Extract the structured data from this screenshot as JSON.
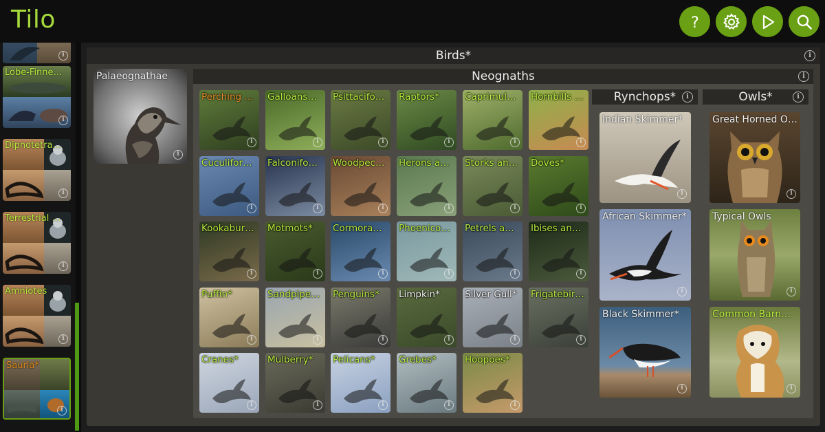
{
  "app": {
    "title": "Tilo"
  },
  "toolbar": {
    "help_icon": "question-mark-icon",
    "settings_icon": "gear-icon",
    "play_icon": "play-icon",
    "search_icon": "search-icon"
  },
  "sidebar": {
    "items": [
      {
        "label": ""
      },
      {
        "label": "Lobe-Finne…"
      },
      {
        "label": "Dipnotetra…"
      },
      {
        "label": "Terrestrial …"
      },
      {
        "label": "Amniotes"
      },
      {
        "label": "Sauria*"
      }
    ]
  },
  "birds": {
    "title": "Birds*",
    "palaeognathae": {
      "label": "Palaeognathae"
    },
    "neognaths": {
      "title": "Neognaths",
      "tiles": [
        {
          "label": "Perching …",
          "color": "orange"
        },
        {
          "label": "Galloans…"
        },
        {
          "label": "Psittacifo…"
        },
        {
          "label": "Raptors*"
        },
        {
          "label": "Caprimul…"
        },
        {
          "label": "Hornbills …"
        },
        {
          "label": "Cuculifor…"
        },
        {
          "label": "Falconifo…"
        },
        {
          "label": "Woodpec…"
        },
        {
          "label": "Herons a…"
        },
        {
          "label": "Storks an…"
        },
        {
          "label": "Doves*"
        },
        {
          "label": "Kookabur…"
        },
        {
          "label": "Motmots*"
        },
        {
          "label": "Cormora…"
        },
        {
          "label": "Phoenico…"
        },
        {
          "label": "Petrels a…"
        },
        {
          "label": "Ibises an…"
        },
        {
          "label": "Puffin*"
        },
        {
          "label": "Sandpipe…"
        },
        {
          "label": "Penguins*"
        },
        {
          "label": "Limpkin*",
          "color": "white"
        },
        {
          "label": "Silver Gull*",
          "color": "white"
        },
        {
          "label": "Frigatebir…"
        },
        {
          "label": "Cranes*"
        },
        {
          "label": "Mulberry*"
        },
        {
          "label": "Pelicans*"
        },
        {
          "label": "Grebes*"
        },
        {
          "label": "Hoopoes*"
        }
      ]
    },
    "rynchops": {
      "title": "Rynchops*",
      "tiles": [
        {
          "label": "Indian Skimmer*"
        },
        {
          "label": "African Skimmer*"
        },
        {
          "label": "Black Skimmer*"
        }
      ]
    },
    "owls": {
      "title": "Owls*",
      "tiles": [
        {
          "label": "Great Horned O…"
        },
        {
          "label": "Typical Owls"
        },
        {
          "label": "Common Barn…"
        }
      ]
    }
  },
  "info_icon": "info-icon",
  "colors": {
    "accent_green": "#6aa013",
    "label_green": "#b8ec3d",
    "panel": "#3a3934",
    "header": "#272624"
  }
}
